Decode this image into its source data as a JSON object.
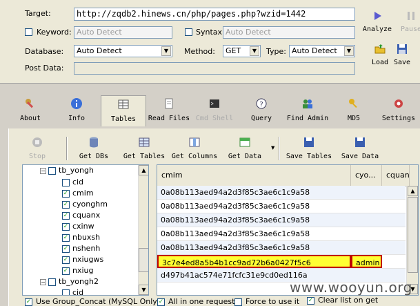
{
  "form": {
    "target_label": "Target:",
    "target_value": "http://zqdb2.hinews.cn/php/pages.php?wzid=1442",
    "keyword_label": "Keyword:",
    "keyword_placeholder": "Auto Detect",
    "syntax_label": "Syntax:",
    "syntax_placeholder": "Auto Detect",
    "database_label": "Database:",
    "database_value": "Auto Detect",
    "method_label": "Method:",
    "method_value": "GET",
    "type_label": "Type:",
    "type_value": "Auto Detect",
    "postdata_label": "Post Data:",
    "postdata_value": ""
  },
  "right_buttons": {
    "analyze": "Analyze",
    "pause": "Pause",
    "load": "Load",
    "save": "Save"
  },
  "tabs": [
    {
      "label": "About"
    },
    {
      "label": "Info"
    },
    {
      "label": "Tables"
    },
    {
      "label": "Read Files"
    },
    {
      "label": "Cmd Shell"
    },
    {
      "label": "Query"
    },
    {
      "label": "Find Admin"
    },
    {
      "label": "MD5"
    },
    {
      "label": "Settings"
    }
  ],
  "toolbar": {
    "stop": "Stop",
    "get_dbs": "Get DBs",
    "get_tables": "Get Tables",
    "get_columns": "Get Columns",
    "get_data": "Get Data",
    "save_tables": "Save Tables",
    "save_data": "Save Data"
  },
  "tree": {
    "table1": "tb_yongh",
    "columns": [
      "cid",
      "cmim",
      "cyonghm",
      "cquanx",
      "cxinw",
      "nbuxsh",
      "nshenh",
      "nxiugws",
      "nxiug"
    ],
    "checked": [
      false,
      true,
      true,
      true,
      true,
      true,
      true,
      true,
      true
    ],
    "table2": "tb_yongh2",
    "table2_col": "cid"
  },
  "grid": {
    "columns": [
      "cmim",
      "cyo...",
      "cquan"
    ],
    "rows": [
      [
        "0a08b113aed94a2d3f85c3ae6c1c9a58",
        "",
        ""
      ],
      [
        "0a08b113aed94a2d3f85c3ae6c1c9a58",
        "",
        ""
      ],
      [
        "0a08b113aed94a2d3f85c3ae6c1c9a58",
        "",
        ""
      ],
      [
        "0a08b113aed94a2d3f85c3ae6c1c9a58",
        "",
        ""
      ],
      [
        "0a08b113aed94a2d3f85c3ae6c1c9a58",
        "",
        ""
      ],
      [
        "3c7e4ed8a5b4b1cc9ad72b6a0427f5c6",
        "admin",
        ""
      ],
      [
        "d497b41ac574e71fcfc31e9cd0ed116a",
        "",
        ""
      ]
    ]
  },
  "status": {
    "group_concat": "Use Group_Concat (MySQL Only)",
    "all_in_one": "All in one request.",
    "force": "Force to use it",
    "clear_list": "Clear list on get"
  },
  "watermark": "www.wooyun.org",
  "colors": {
    "highlight": "#ffff33",
    "highlight_border": "#c00000",
    "check": "#21a121"
  }
}
